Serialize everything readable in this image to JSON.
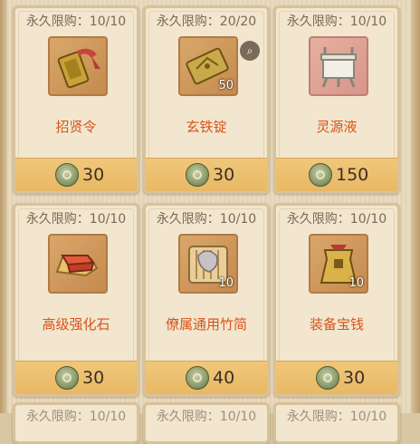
{
  "items": [
    {
      "limit": "永久限购：10/10",
      "name": "招贤令",
      "price": "30",
      "icon": "recruit-token-icon"
    },
    {
      "limit": "永久限购：20/20",
      "name": "玄铁锭",
      "price": "30",
      "qty": "50",
      "icon": "iron-ingot-icon"
    },
    {
      "limit": "永久限购：10/10",
      "name": "灵源液",
      "price": "150",
      "icon": "cauldron-icon"
    },
    {
      "limit": "永久限购：10/10",
      "name": "高级强化石",
      "price": "30",
      "icon": "strengthen-stone-icon"
    },
    {
      "limit": "永久限购：10/10",
      "name": "僚属通用竹简",
      "price": "40",
      "qty": "10",
      "icon": "bamboo-scroll-icon"
    },
    {
      "limit": "永久限购：10/10",
      "name": "装备宝钱",
      "price": "30",
      "qty": "10",
      "icon": "equipment-coin-icon"
    }
  ],
  "partial_row": [
    "永久限购：10/10",
    "永久限购：10/10",
    "永久限购：10/10"
  ]
}
